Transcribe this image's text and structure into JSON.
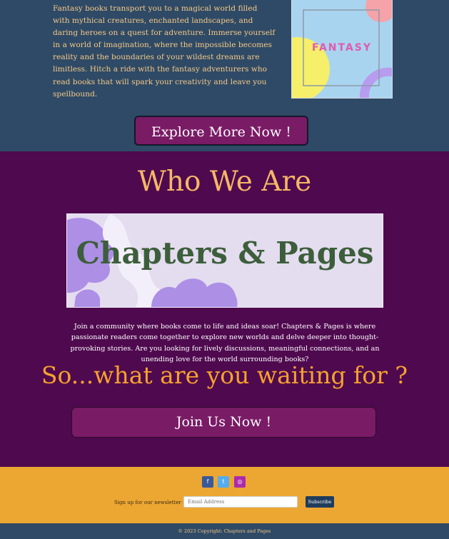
{
  "intro": {
    "text": "Fantasy books transport you to a magical world filled with mythical creatures, enchanted landscapes, and daring heroes on a quest for adventure. Immerse yourself in a world of imagination, where the impossible becomes reality and the boundaries of your wildest dreams are limitless. Hitch a ride with the fantasy adventurers who read books that will spark your creativity and leave you spellbound.",
    "cover_label": "FANTASY",
    "explore_button": "Explore More Now !"
  },
  "about": {
    "title": "Who We Are",
    "banner_text": "Chapters & Pages",
    "description": "Join a community where books come to life and ideas soar! Chapters & Pages is where passionate readers come together to explore new worlds and delve deeper into thought-provoking stories. Are you looking for lively discussions, meaningful connections, and an unending love for the world surrounding books?",
    "cta_heading": "So...what are you waiting for ?",
    "join_button": "Join Us Now !"
  },
  "footer": {
    "social": [
      {
        "name": "facebook-icon",
        "glyph": "f"
      },
      {
        "name": "twitter-icon",
        "glyph": "t"
      },
      {
        "name": "instagram-icon",
        "glyph": "◎"
      }
    ],
    "newsletter_label": "Sign up for our newsletter :",
    "email_placeholder": "Email Address",
    "subscribe_button": "Subscribe",
    "copyright": "© 2023 Copyright: Chapters and Pages"
  },
  "colors": {
    "top_bg": "#2e4a66",
    "mid_bg": "#4f0a4f",
    "footer_bg": "#eca733",
    "button_bg": "#7a1b66",
    "accent": "#f6b766"
  }
}
